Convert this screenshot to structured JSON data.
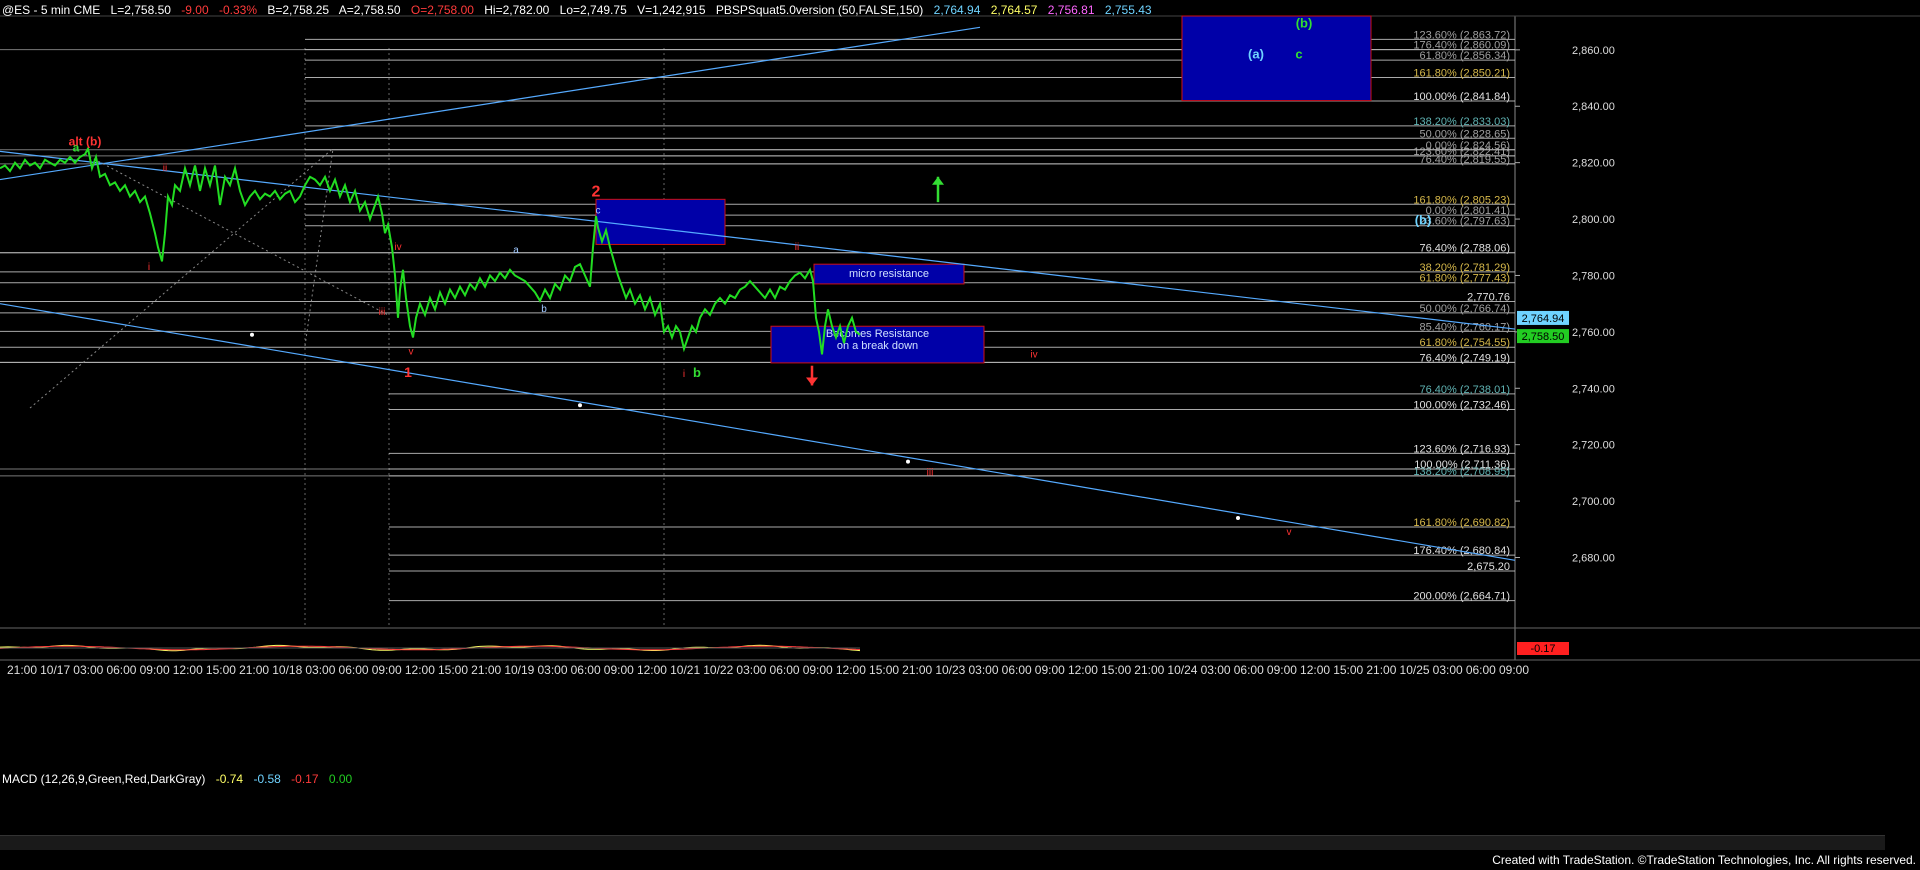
{
  "header": {
    "symbol": "@ES - 5 min  CME",
    "last": "L=2,758.50",
    "chg": "-9.00",
    "pct": "-0.33%",
    "bid": "B=2,758.25",
    "ask": "A=2,758.50",
    "open": "O=2,758.00",
    "hi": "Hi=2,782.00",
    "lo": "Lo=2,749.75",
    "vol": "V=1,242,915",
    "study": "PBSPSquat5.0version (50,FALSE,150)",
    "v1": "2,764.94",
    "v2": "2,764.57",
    "v3": "2,756.81",
    "v4": "2,755.43",
    "colors": {
      "symbol": "#ffffff",
      "last": "#ffffff",
      "chg": "#ff3b3b",
      "open": "#ff3b3b",
      "v1": "#6fd3ff",
      "v2": "#ffff66",
      "v3": "#ff66ff",
      "v4": "#6fd3ff"
    }
  },
  "chart_data": {
    "type": "line",
    "title": "@ES - 5 min CME",
    "ylim": [
      2655,
      2872
    ],
    "y_ticks": [
      2680,
      2700,
      2720,
      2740,
      2760,
      2780,
      2800,
      2820,
      2840,
      2860
    ],
    "y_tick_labels": [
      "2,680.00",
      "2,700.00",
      "2,720.00",
      "2,740.00",
      "2,760.00",
      "2,780.00",
      "2,800.00",
      "2,820.00",
      "2,840.00",
      "2,860.00"
    ],
    "x_tick_labels": [
      "21:00",
      "10/17",
      "03:00",
      "06:00",
      "09:00",
      "12:00",
      "15:00",
      "21:00",
      "10/18",
      "03:00",
      "06:00",
      "09:00",
      "12:00",
      "15:00",
      "21:00",
      "10/19",
      "03:00",
      "06:00",
      "09:00",
      "12:00",
      "10/21",
      "10/22",
      "03:00",
      "06:00",
      "09:00",
      "12:00",
      "15:00",
      "21:00",
      "10/23",
      "03:00",
      "06:00",
      "09:00",
      "12:00",
      "15:00",
      "21:00",
      "10/24",
      "03:00",
      "06:00",
      "09:00",
      "12:00",
      "15:00",
      "21:00",
      "10/25",
      "03:00",
      "06:00",
      "09:00"
    ],
    "price_series": [
      [
        0,
        2818
      ],
      [
        5,
        2819
      ],
      [
        10,
        2817
      ],
      [
        15,
        2820
      ],
      [
        20,
        2818
      ],
      [
        25,
        2821
      ],
      [
        30,
        2819
      ],
      [
        35,
        2820
      ],
      [
        40,
        2818
      ],
      [
        45,
        2821
      ],
      [
        50,
        2820
      ],
      [
        55,
        2819
      ],
      [
        60,
        2821
      ],
      [
        65,
        2820
      ],
      [
        70,
        2822
      ],
      [
        75,
        2820
      ],
      [
        80,
        2822
      ],
      [
        85,
        2823
      ],
      [
        88,
        2825
      ],
      [
        92,
        2818
      ],
      [
        96,
        2822
      ],
      [
        100,
        2815
      ],
      [
        105,
        2816
      ],
      [
        110,
        2812
      ],
      [
        115,
        2813
      ],
      [
        120,
        2810
      ],
      [
        125,
        2812
      ],
      [
        130,
        2808
      ],
      [
        135,
        2810
      ],
      [
        140,
        2806
      ],
      [
        145,
        2808
      ],
      [
        150,
        2802
      ],
      [
        155,
        2795
      ],
      [
        158,
        2790
      ],
      [
        162,
        2785
      ],
      [
        165,
        2795
      ],
      [
        168,
        2808
      ],
      [
        172,
        2805
      ],
      [
        175,
        2812
      ],
      [
        180,
        2810
      ],
      [
        185,
        2818
      ],
      [
        190,
        2812
      ],
      [
        195,
        2819
      ],
      [
        200,
        2810
      ],
      [
        205,
        2818
      ],
      [
        210,
        2812
      ],
      [
        215,
        2819
      ],
      [
        220,
        2805
      ],
      [
        225,
        2815
      ],
      [
        230,
        2812
      ],
      [
        235,
        2818
      ],
      [
        240,
        2810
      ],
      [
        245,
        2805
      ],
      [
        250,
        2808
      ],
      [
        255,
        2810
      ],
      [
        260,
        2807
      ],
      [
        265,
        2809
      ],
      [
        270,
        2808
      ],
      [
        275,
        2810
      ],
      [
        280,
        2807
      ],
      [
        285,
        2809
      ],
      [
        290,
        2810
      ],
      [
        295,
        2806
      ],
      [
        300,
        2808
      ],
      [
        305,
        2812
      ],
      [
        310,
        2815
      ],
      [
        315,
        2814
      ],
      [
        320,
        2812
      ],
      [
        325,
        2815
      ],
      [
        330,
        2810
      ],
      [
        335,
        2814
      ],
      [
        340,
        2808
      ],
      [
        345,
        2812
      ],
      [
        350,
        2806
      ],
      [
        355,
        2810
      ],
      [
        360,
        2803
      ],
      [
        365,
        2806
      ],
      [
        370,
        2800
      ],
      [
        375,
        2805
      ],
      [
        378,
        2808
      ],
      [
        382,
        2802
      ],
      [
        385,
        2795
      ],
      [
        388,
        2798
      ],
      [
        392,
        2790
      ],
      [
        395,
        2780
      ],
      [
        398,
        2765
      ],
      [
        400,
        2775
      ],
      [
        403,
        2782
      ],
      [
        406,
        2772
      ],
      [
        410,
        2762
      ],
      [
        413,
        2758
      ],
      [
        416,
        2765
      ],
      [
        420,
        2770
      ],
      [
        425,
        2766
      ],
      [
        430,
        2772
      ],
      [
        435,
        2768
      ],
      [
        440,
        2774
      ],
      [
        445,
        2770
      ],
      [
        450,
        2775
      ],
      [
        455,
        2772
      ],
      [
        460,
        2776
      ],
      [
        465,
        2773
      ],
      [
        470,
        2777
      ],
      [
        475,
        2775
      ],
      [
        480,
        2779
      ],
      [
        485,
        2776
      ],
      [
        490,
        2780
      ],
      [
        495,
        2778
      ],
      [
        500,
        2781
      ],
      [
        505,
        2779
      ],
      [
        510,
        2782
      ],
      [
        515,
        2780
      ],
      [
        520,
        2779
      ],
      [
        525,
        2778
      ],
      [
        530,
        2776
      ],
      [
        535,
        2774
      ],
      [
        540,
        2771
      ],
      [
        545,
        2775
      ],
      [
        550,
        2772
      ],
      [
        555,
        2777
      ],
      [
        560,
        2775
      ],
      [
        565,
        2780
      ],
      [
        570,
        2778
      ],
      [
        575,
        2783
      ],
      [
        580,
        2784
      ],
      [
        585,
        2780
      ],
      [
        590,
        2776
      ],
      [
        593,
        2790
      ],
      [
        596,
        2801
      ],
      [
        598,
        2797
      ],
      [
        602,
        2792
      ],
      [
        606,
        2796
      ],
      [
        610,
        2790
      ],
      [
        614,
        2785
      ],
      [
        618,
        2780
      ],
      [
        622,
        2776
      ],
      [
        626,
        2772
      ],
      [
        630,
        2775
      ],
      [
        635,
        2770
      ],
      [
        640,
        2773
      ],
      [
        645,
        2768
      ],
      [
        650,
        2772
      ],
      [
        655,
        2766
      ],
      [
        660,
        2770
      ],
      [
        664,
        2760
      ],
      [
        668,
        2762
      ],
      [
        672,
        2758
      ],
      [
        676,
        2762
      ],
      [
        680,
        2760
      ],
      [
        684,
        2754
      ],
      [
        688,
        2758
      ],
      [
        692,
        2762
      ],
      [
        696,
        2760
      ],
      [
        700,
        2765
      ],
      [
        705,
        2768
      ],
      [
        710,
        2766
      ],
      [
        715,
        2770
      ],
      [
        720,
        2772
      ],
      [
        725,
        2770
      ],
      [
        730,
        2773
      ],
      [
        735,
        2772
      ],
      [
        740,
        2775
      ],
      [
        745,
        2776
      ],
      [
        750,
        2778
      ],
      [
        755,
        2776
      ],
      [
        760,
        2774
      ],
      [
        765,
        2772
      ],
      [
        770,
        2775
      ],
      [
        775,
        2772
      ],
      [
        780,
        2776
      ],
      [
        785,
        2775
      ],
      [
        790,
        2778
      ],
      [
        795,
        2780
      ],
      [
        800,
        2781
      ],
      [
        805,
        2779
      ],
      [
        810,
        2782
      ],
      [
        813,
        2778
      ],
      [
        816,
        2765
      ],
      [
        819,
        2760
      ],
      [
        822,
        2752
      ],
      [
        825,
        2762
      ],
      [
        828,
        2768
      ],
      [
        832,
        2762
      ],
      [
        836,
        2758
      ],
      [
        840,
        2762
      ],
      [
        844,
        2756
      ],
      [
        848,
        2762
      ],
      [
        852,
        2765
      ],
      [
        856,
        2760
      ],
      [
        860,
        2759
      ]
    ],
    "trendlines": [
      {
        "x1": 0,
        "y1": 2814,
        "x2": 980,
        "y2": 2868,
        "color": "#55aaff"
      },
      {
        "x1": 0,
        "y1": 2824,
        "x2": 1515,
        "y2": 2761,
        "color": "#55aaff"
      },
      {
        "x1": 0,
        "y1": 2770,
        "x2": 1515,
        "y2": 2679,
        "color": "#55aaff"
      }
    ],
    "fib_levels": [
      {
        "label": "123.60% (2,863.72)",
        "value": 2863.72,
        "color": "#a0a0a0"
      },
      {
        "label": "176.40% (2,860.09)",
        "value": 2860.09,
        "color": "#a0a0a0"
      },
      {
        "label": "61.80% (2,856.34)",
        "value": 2856.34,
        "color": "#a0a0a0"
      },
      {
        "label": "161.80% (2,850.21)",
        "value": 2850.21,
        "color": "#d6b84a"
      },
      {
        "label": "100.00% (2,841.84)",
        "value": 2841.84,
        "color": "#e0e0e0"
      },
      {
        "label": "138.20% (2,833.03)",
        "value": 2833.03,
        "color": "#5fb3b3"
      },
      {
        "label": "50.00% (2,828.65)",
        "value": 2828.65,
        "color": "#a0a0a0"
      },
      {
        "label": "0.00% (2,824.56)",
        "value": 2824.56,
        "color": "#a0a0a0"
      },
      {
        "label": "123.60% (2,822.41)",
        "value": 2822.41,
        "color": "#a0a0a0"
      },
      {
        "label": "76.40% (2,819.55)",
        "value": 2819.55,
        "color": "#a0a0a0"
      },
      {
        "label": "161.80% (2,805.23)",
        "value": 2805.23,
        "color": "#d6b84a"
      },
      {
        "label": "0.00% (2,801.41)",
        "value": 2801.41,
        "color": "#a0a0a0"
      },
      {
        "label": "23.60% (2,797.63)",
        "value": 2797.63,
        "color": "#a0a0a0"
      },
      {
        "label": "76.40% (2,788.06)",
        "value": 2788.06,
        "color": "#e0e0e0"
      },
      {
        "label": "38.20% (2,781.29)",
        "value": 2781.29,
        "color": "#d6b84a"
      },
      {
        "label": "61.80% (2,777.43)",
        "value": 2777.43,
        "color": "#d6b84a"
      },
      {
        "label": "2,770.76",
        "value": 2770.76,
        "color": "#e0e0e0"
      },
      {
        "label": "50.00% (2,766.74)",
        "value": 2766.74,
        "color": "#a0a0a0"
      },
      {
        "label": "85.40% (2,760.17)",
        "value": 2760.17,
        "color": "#a0a0a0"
      },
      {
        "label": "61.80% (2,754.55)",
        "value": 2754.55,
        "color": "#d6b84a"
      },
      {
        "label": "76.40% (2,749.19)",
        "value": 2749.19,
        "color": "#e0e0e0"
      },
      {
        "label": "76.40% (2,738.01)",
        "value": 2738.01,
        "color": "#5fb3b3"
      },
      {
        "label": "100.00% (2,732.46)",
        "value": 2732.46,
        "color": "#e0e0e0"
      },
      {
        "label": "123.60% (2,716.93)",
        "value": 2716.93,
        "color": "#e0e0e0"
      },
      {
        "label": "100.00% (2,711.36)",
        "value": 2711.36,
        "color": "#e0e0e0"
      },
      {
        "label": "138.20% (2,708.95)",
        "value": 2708.95,
        "color": "#5fb3b3"
      },
      {
        "label": "161.80% (2,690.82)",
        "value": 2690.82,
        "color": "#d6b84a"
      },
      {
        "label": "176.40% (2,680.84)",
        "value": 2680.84,
        "color": "#e0e0e0"
      },
      {
        "label": "2,675.20",
        "value": 2675.2,
        "color": "#e0e0e0"
      },
      {
        "label": "200.00% (2,664.71)",
        "value": 2664.71,
        "color": "#e0e0e0"
      }
    ],
    "boxes": [
      {
        "x1": 1182,
        "x2": 1371,
        "y1": 2842,
        "y2": 2872,
        "label": "",
        "color": "#0000a8",
        "border": "#d01010"
      },
      {
        "x1": 596,
        "x2": 725,
        "y1": 2791,
        "y2": 2807,
        "label": "",
        "color": "#0000a8",
        "border": "#d01010"
      },
      {
        "x1": 814,
        "x2": 964,
        "y1": 2777,
        "y2": 2784,
        "label": "micro resistance",
        "color": "#0000a8",
        "border": "#d01010"
      },
      {
        "x1": 771,
        "x2": 984,
        "y1": 2749,
        "y2": 2762,
        "label": "Becomes Resistance\non a break down",
        "color": "#0000a8",
        "border": "#d01010"
      }
    ],
    "wave_labels": [
      {
        "text": "a",
        "x": 76,
        "y": 2824,
        "color": "#33dd33",
        "size": 12,
        "bold": true
      },
      {
        "text": "alt (b)",
        "x": 85,
        "y": 2826,
        "color": "#ff3333",
        "size": 12,
        "bold": true
      },
      {
        "text": "ii",
        "x": 165,
        "y": 2817,
        "color": "#ff3333",
        "size": 10,
        "bold": false
      },
      {
        "text": "i",
        "x": 149,
        "y": 2782,
        "color": "#ff3333",
        "size": 10,
        "bold": false
      },
      {
        "text": "iv",
        "x": 398,
        "y": 2789,
        "color": "#ff3333",
        "size": 10,
        "bold": false
      },
      {
        "text": "iii",
        "x": 382,
        "y": 2766,
        "color": "#ff3333",
        "size": 10,
        "bold": false
      },
      {
        "text": "v",
        "x": 411,
        "y": 2752,
        "color": "#ff3333",
        "size": 10,
        "bold": false
      },
      {
        "text": "1",
        "x": 408,
        "y": 2744,
        "color": "#ff3333",
        "size": 14,
        "bold": true
      },
      {
        "text": "a",
        "x": 516,
        "y": 2788,
        "color": "#9fc8ff",
        "size": 10,
        "bold": false
      },
      {
        "text": "b",
        "x": 544,
        "y": 2767,
        "color": "#9fc8ff",
        "size": 10,
        "bold": false
      },
      {
        "text": "2",
        "x": 596,
        "y": 2808,
        "color": "#ff3333",
        "size": 16,
        "bold": true
      },
      {
        "text": "c",
        "x": 598,
        "y": 2802,
        "color": "#9fc8ff",
        "size": 10,
        "bold": false
      },
      {
        "text": "i",
        "x": 684,
        "y": 2744,
        "color": "#ff3333",
        "size": 10,
        "bold": false
      },
      {
        "text": "b",
        "x": 697,
        "y": 2744,
        "color": "#33dd33",
        "size": 13,
        "bold": true
      },
      {
        "text": "ii",
        "x": 797,
        "y": 2789,
        "color": "#ff3333",
        "size": 10,
        "bold": false
      },
      {
        "text": "iv",
        "x": 1034,
        "y": 2751,
        "color": "#ff3333",
        "size": 10,
        "bold": false
      },
      {
        "text": "iii",
        "x": 930,
        "y": 2709,
        "color": "#ff3333",
        "size": 10,
        "bold": false
      },
      {
        "text": "v",
        "x": 1289,
        "y": 2688,
        "color": "#ff3333",
        "size": 10,
        "bold": false
      },
      {
        "text": "(a)",
        "x": 1256,
        "y": 2857,
        "color": "#6fd3ff",
        "size": 13,
        "bold": true
      },
      {
        "text": "(b)",
        "x": 1304,
        "y": 2868,
        "color": "#33dd33",
        "size": 13,
        "bold": true
      },
      {
        "text": "c",
        "x": 1299,
        "y": 2857,
        "color": "#33dd33",
        "size": 13,
        "bold": true
      },
      {
        "text": "(b)",
        "x": 1423,
        "y": 2798,
        "color": "#6fd3ff",
        "size": 13,
        "bold": true
      }
    ],
    "arrows": [
      {
        "x": 938,
        "y_from": 2806,
        "y_to": 2815,
        "dir": "up",
        "color": "#33dd33"
      },
      {
        "x": 812,
        "y_from": 2748,
        "y_to": 2741,
        "dir": "down",
        "color": "#ff3333"
      }
    ],
    "markers": [
      {
        "x": 252,
        "y": 2759
      },
      {
        "x": 580,
        "y": 2734
      },
      {
        "x": 908,
        "y": 2714
      },
      {
        "x": 1238,
        "y": 2694
      }
    ],
    "price_tags": [
      {
        "label": "2,764.94",
        "value": 2764.94,
        "color": "#6fd3ff"
      },
      {
        "label": "2,758.50",
        "value": 2758.5,
        "color": "#22cc22"
      }
    ]
  },
  "macd": {
    "label": "MACD (12,26,9,Green,Red,DarkGray)",
    "v1": "-0.74",
    "v2": "-0.58",
    "v3": "-0.17",
    "v4": "0.00",
    "axis_label": "-0.17",
    "colors": {
      "v1": "#ffff66",
      "v2": "#6fd3ff",
      "v3": "#ff3b3b",
      "v4": "#22cc22"
    }
  },
  "credit": "Created with TradeStation. ©TradeStation Technologies, Inc. All rights reserved."
}
